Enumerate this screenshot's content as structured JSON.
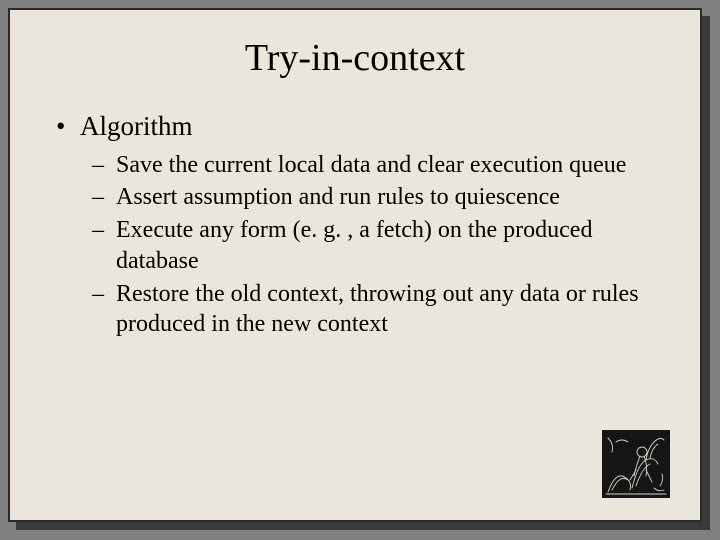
{
  "slide": {
    "title": "Try-in-context",
    "bullets_l1": [
      {
        "text": "Algorithm"
      }
    ],
    "bullets_l2": [
      {
        "text": "Save the current local data and clear execution queue"
      },
      {
        "text": "Assert assumption and run rules to quiescence"
      },
      {
        "text": "Execute any form (e. g. , a fetch) on the produced database"
      },
      {
        "text": "Restore the old context, throwing out any data or rules produced in the new context"
      }
    ]
  }
}
